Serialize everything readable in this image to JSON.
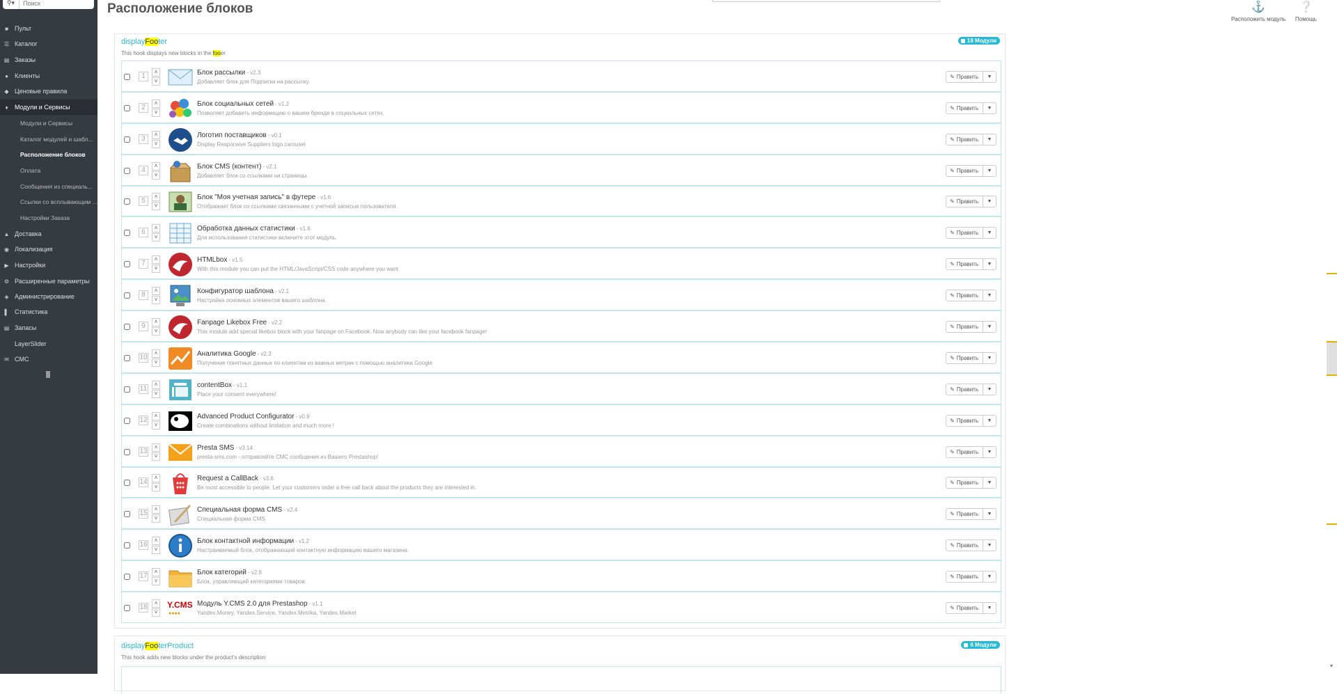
{
  "search": {
    "placeholder": "Поиск"
  },
  "sidebar": {
    "items": [
      {
        "label": "Пульт",
        "icon": "dashboard-icon"
      },
      {
        "label": "Каталог",
        "icon": "catalog-icon"
      },
      {
        "label": "Заказы",
        "icon": "orders-icon"
      },
      {
        "label": "Клиенты",
        "icon": "customers-icon"
      },
      {
        "label": "Ценовые правила",
        "icon": "price-rules-icon"
      },
      {
        "label": "Модули и Сервисы",
        "icon": "modules-icon"
      },
      {
        "label": "Доставка",
        "icon": "truck-icon"
      },
      {
        "label": "Локализация",
        "icon": "globe-icon"
      },
      {
        "label": "Настройки",
        "icon": "wrench-icon"
      },
      {
        "label": "Расширенные параметры",
        "icon": "cogs-icon"
      },
      {
        "label": "Администрирование",
        "icon": "admin-icon"
      },
      {
        "label": "Статистика",
        "icon": "stats-icon"
      },
      {
        "label": "Запасы",
        "icon": "stock-icon"
      },
      {
        "label": "LayerSlider",
        "icon": ""
      },
      {
        "label": "CMC",
        "icon": "mail-icon"
      }
    ],
    "subitems": [
      {
        "label": "Модули и Сервисы"
      },
      {
        "label": "Каталог модулей и шабл..."
      },
      {
        "label": "Расположение блоков"
      },
      {
        "label": "Оплата"
      },
      {
        "label": "Сообщения из специаль..."
      },
      {
        "label": "Ссылки со всплывающим ..."
      },
      {
        "label": "Настройки Заказа"
      }
    ]
  },
  "header": {
    "title": "Расположение блоков",
    "transplant_label": "Расположить модуль",
    "help_label": "Помощь"
  },
  "hooks": [
    {
      "prefix": "display",
      "highlight": "Foo",
      "suffix": "ter",
      "desc_before": "This hook displays new blocks in the ",
      "desc_highlight": "foo",
      "desc_after": "er",
      "badge": "18 Модули"
    },
    {
      "prefix": "display",
      "highlight": "Foo",
      "suffix": "terProduct",
      "desc_before": "This hook adds new blocks under the product's description",
      "desc_highlight": "",
      "desc_after": "",
      "badge": "6 Модули"
    }
  ],
  "edit_label": "Править",
  "modules": [
    {
      "pos": "1",
      "name": "Блок рассылки",
      "version": "- v2.3",
      "desc": "Добавляет блок для Подписки на рассылку.",
      "icon": "envelope-icon"
    },
    {
      "pos": "2",
      "name": "Блок социальных сетей",
      "version": "- v1.2",
      "desc": "Позволяет добавить информацию о вашем бренде в социальных сетях.",
      "icon": "social-balls-icon"
    },
    {
      "pos": "3",
      "name": "Логотип поставщиков",
      "version": "- v0.1",
      "desc": "Display Responsive Suppliers logo carousel",
      "icon": "handshake-icon"
    },
    {
      "pos": "4",
      "name": "Блок CMS (контент)",
      "version": "- v2.1",
      "desc": "Добавляет блок со ссылками на страницы.",
      "icon": "cms-box-icon"
    },
    {
      "pos": "5",
      "name": "Блок \"Моя учетная запись\" в футере",
      "version": "- v1.6",
      "desc": "Отображает блок со ссылками связанными с учетной записью пользователя.",
      "icon": "account-icon"
    },
    {
      "pos": "6",
      "name": "Обработка данных статистики",
      "version": "- v1.6",
      "desc": "Для использования статистики включите этот модуль.",
      "icon": "spreadsheet-icon"
    },
    {
      "pos": "7",
      "name": "HTMLbox",
      "version": "- v1.5",
      "desc": "With this module you can put the HTML/JavaScript/CSS code anywhere you want",
      "icon": "vekia-icon"
    },
    {
      "pos": "8",
      "name": "Конфигуратор шаблона",
      "version": "- v2.1",
      "desc": "Настройка основных элементов вашего шаблона.",
      "icon": "picture-icon"
    },
    {
      "pos": "9",
      "name": "Fanpage Likebox Free",
      "version": "- v2.2",
      "desc": "This module add special likebox block with your fanpage on Facebook. Now anybody can like your facebook fanpage!",
      "icon": "vekia-icon"
    },
    {
      "pos": "10",
      "name": "Аналитика Google",
      "version": "- v2.3",
      "desc": "Получение понятных данных по клиентам из важных метрик с помощью аналитики Google",
      "icon": "analytics-icon"
    },
    {
      "pos": "11",
      "name": "contentBox",
      "version": "- v1.1",
      "desc": "Place your consent everywhere!",
      "icon": "contentbox-icon"
    },
    {
      "pos": "12",
      "name": "Advanced Product Configurator",
      "version": "- v0.9",
      "desc": "Create combinations without limitation and much more !",
      "icon": "palette-icon"
    },
    {
      "pos": "13",
      "name": "Presta SMS",
      "version": "- v3.14",
      "desc": "presta-sms.com - отправляйте СМС сообщения из Вашего Prestashop!",
      "icon": "sms-envelope-icon"
    },
    {
      "pos": "14",
      "name": "Request a CallBack",
      "version": "- v3.6",
      "desc": "Be most accessible to people. Let your customers order a free call back about the products they are interested in.",
      "icon": "phone-keypad-icon"
    },
    {
      "pos": "15",
      "name": "Специальная форма CMS",
      "version": "- v2.4",
      "desc": "Специальная форма CMS",
      "icon": "quill-icon"
    },
    {
      "pos": "16",
      "name": "Блок контактной информации",
      "version": "- v1.2",
      "desc": "Настраиваемый блок, отображающий контактную информацию вашего магазина.",
      "icon": "info-icon"
    },
    {
      "pos": "17",
      "name": "Блок категорий",
      "version": "- v2.9",
      "desc": "Блок, управляющий категориями товаров.",
      "icon": "folder-icon"
    },
    {
      "pos": "18",
      "name": "Модуль Y.CMS 2.0 для Prestashop",
      "version": "- v1.1",
      "desc": "Yandex.Money, Yandex.Service, Yandex.Metrika, Yandex.Market",
      "icon": "ycms-logo-icon",
      "logo_text": "Y.CMS"
    }
  ]
}
